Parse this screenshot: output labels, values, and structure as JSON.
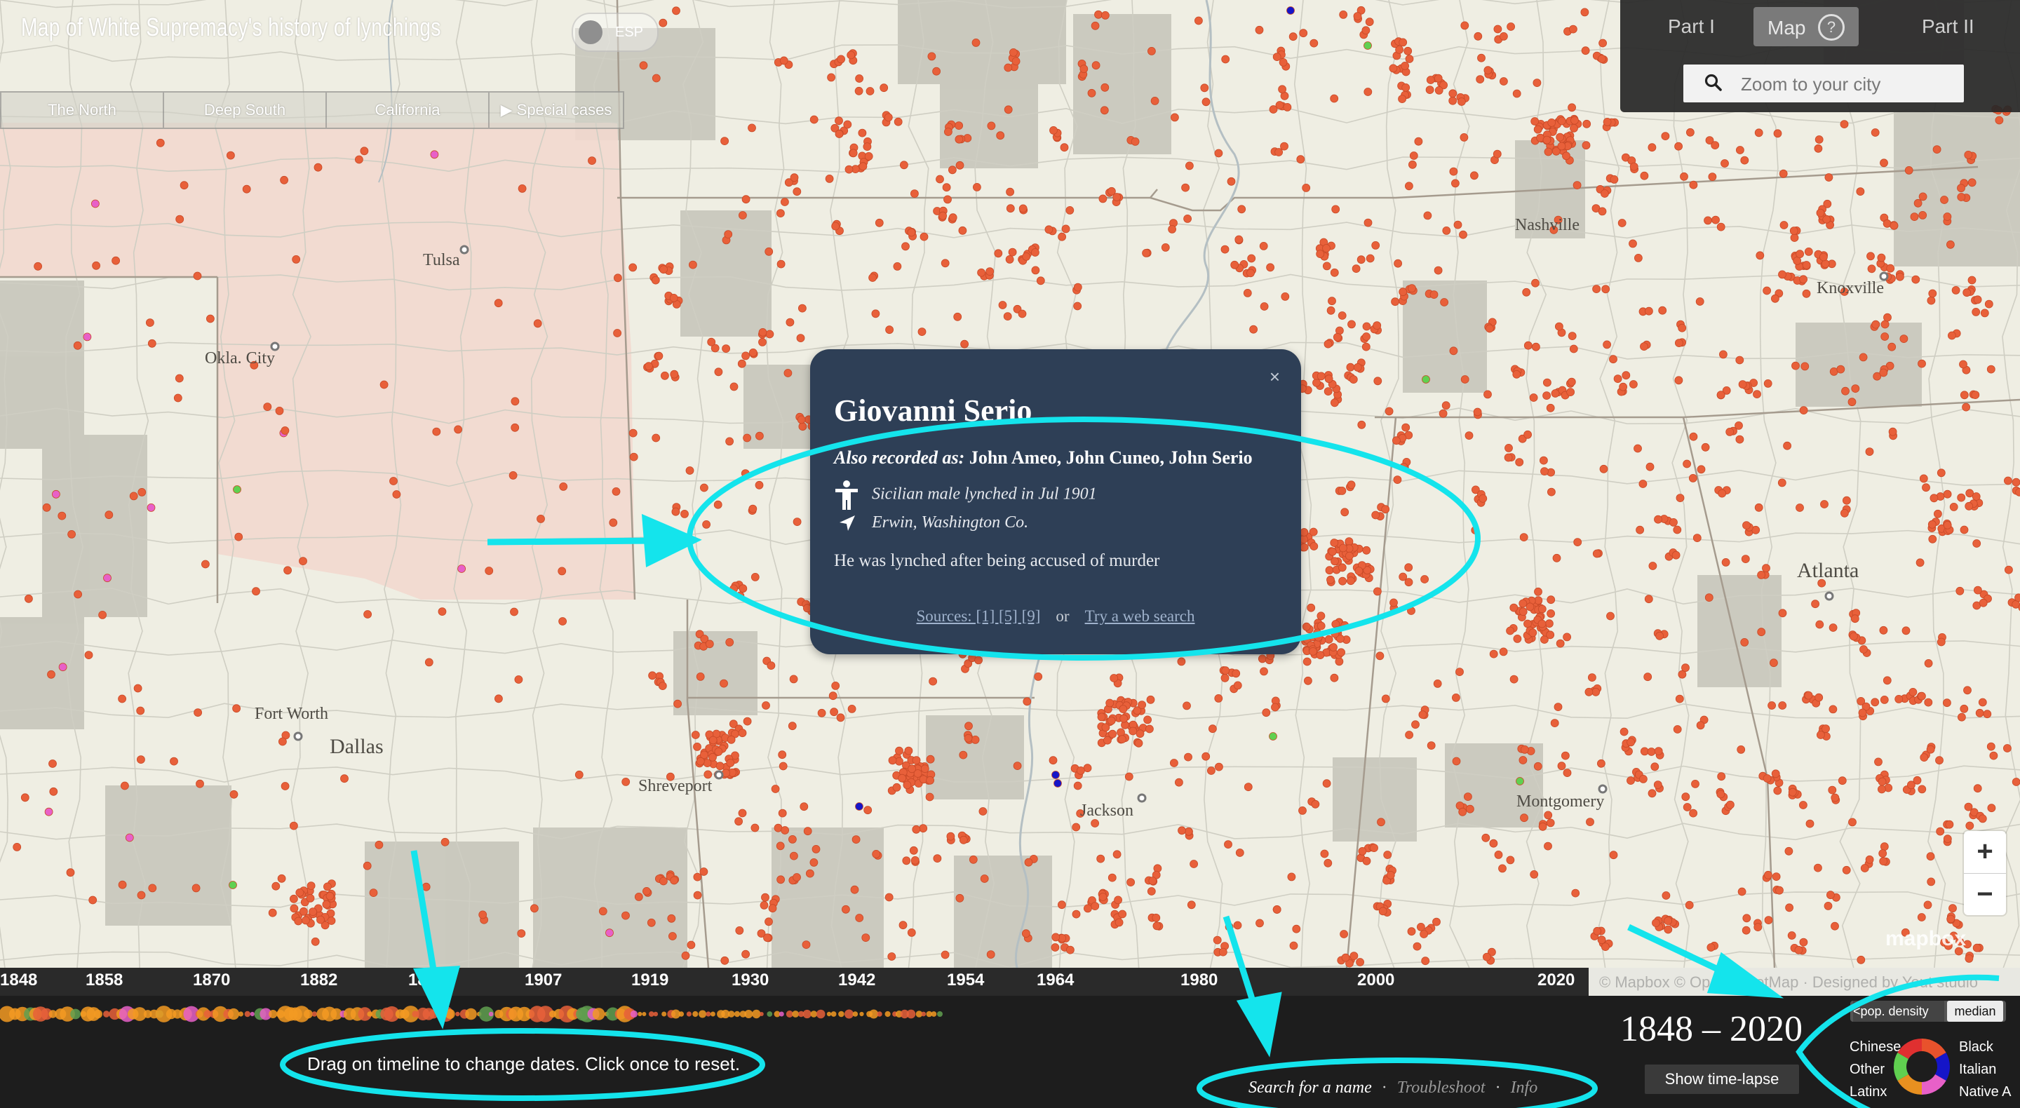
{
  "header": {
    "title": "Map of White Supremacy's history of lynchings",
    "lang_toggle_label": "ESP",
    "region_tabs": [
      "The North",
      "Deep South",
      "California",
      "▶ Special cases"
    ]
  },
  "nav": {
    "part1": "Part I",
    "map": "Map",
    "part2": "Part II",
    "search_placeholder": "Zoom to your city"
  },
  "map": {
    "cities": [
      "Tulsa",
      "Okla. City",
      "Fort Worth",
      "Dallas",
      "Shreveport",
      "Jackson",
      "Nashville",
      "Knoxville",
      "Atlanta",
      "Montgomery"
    ],
    "zoom_in": "+",
    "zoom_out": "−",
    "attribution": "© Mapbox © OpenStreetMap · Designed by Yeut studio",
    "mapbox_logo": "mapbox"
  },
  "popup": {
    "close": "×",
    "name": "Giovanni Serio",
    "aka_label": "Also recorded as:",
    "aka_names": "John Ameo, John Cuneo, John Serio",
    "victim_info": "Sicilian male lynched in Jul 1901",
    "location": "Erwin, Washington Co.",
    "description": "He was lynched after being accused of murder",
    "sources_label": "Sources: [1] [5] [9]",
    "or_label": "or",
    "web_search_label": "Try a web search"
  },
  "timeline": {
    "years": [
      "1848",
      "1858",
      "1870",
      "1882",
      "1894",
      "1907",
      "1919",
      "1930",
      "1942",
      "1954",
      "1964",
      "1980",
      "2000",
      "2020"
    ],
    "hint": "Drag on timeline to change dates. Click once to reset."
  },
  "footer": {
    "search_name": "Search for a name",
    "troubleshoot": "Troubleshoot",
    "info": "Info",
    "date_range": "1848 – 2020",
    "timelapse_button": "Show time-lapse",
    "pop_density_label": "<pop. density",
    "median_label": "median"
  },
  "legend": {
    "items": [
      "Chinese",
      "Other",
      "Latinx",
      "Black",
      "Italian",
      "Native A"
    ],
    "colors": {
      "black": "#e8522c",
      "italian": "#1515c8",
      "native": "#e860c8",
      "latinx": "#e89020",
      "other": "#60d050",
      "chinese": "#e03030"
    }
  },
  "colors": {
    "map_background": "#efeee3",
    "county_gray": "#c6c5ba",
    "oklahoma_pink": "#f2d8ce",
    "marker_orange": "#e8603a",
    "popup_bg": "#2e3f56",
    "annotation_cyan": "#14e4ec"
  }
}
